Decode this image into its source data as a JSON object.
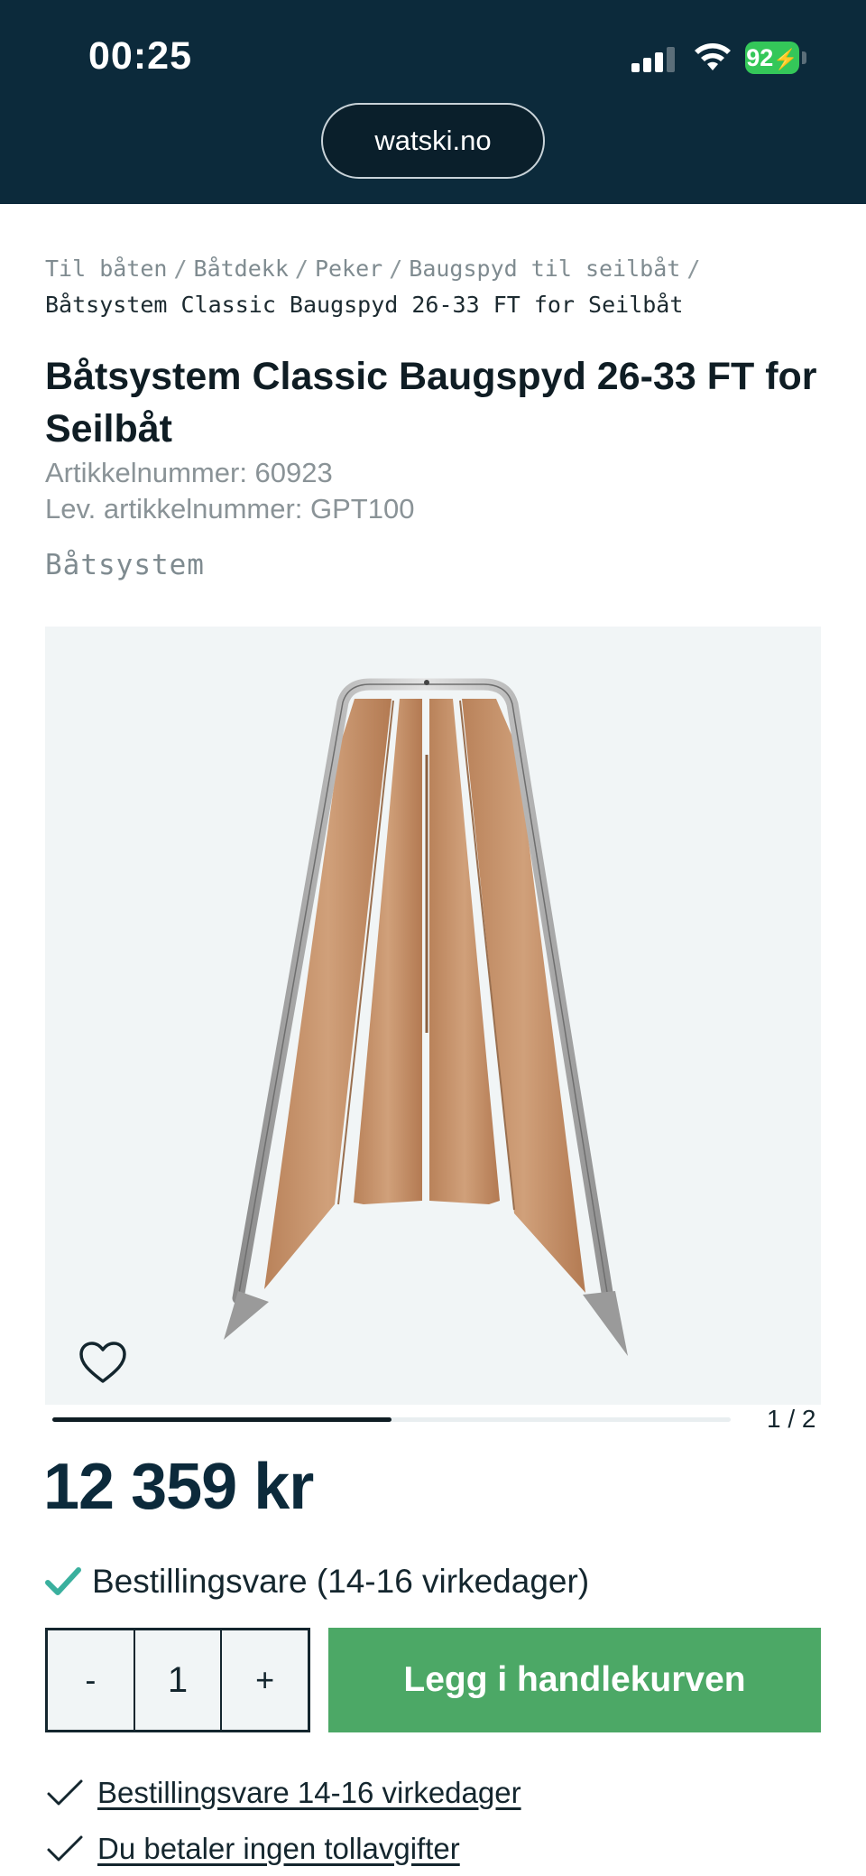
{
  "status_bar": {
    "time": "00:25",
    "battery": "92"
  },
  "browser": {
    "url": "watski.no"
  },
  "breadcrumb": {
    "items": [
      "Til båten",
      "Båtdekk",
      "Peker",
      "Baugspyd til seilbåt"
    ],
    "separator": "/",
    "current": "Båtsystem Classic Baugspyd 26-33 FT for Seilbåt"
  },
  "product": {
    "title": "Båtsystem Classic Baugspyd 26-33 FT for Seilbåt",
    "article_number": "Artikkelnummer: 60923",
    "supplier_article_number": "Lev. artikkelnummer: GPT100",
    "brand": "Båtsystem",
    "price": "12 359 kr",
    "stock_status": "Bestillingsvare (14-16 virkedager)"
  },
  "gallery": {
    "pager": "1 / 2",
    "current_image": 1,
    "total_images": 2,
    "progress_fraction": 0.5
  },
  "cart": {
    "decrement_label": "-",
    "quantity": "1",
    "increment_label": "+",
    "add_label": "Legg i handlekurven"
  },
  "usps": [
    "Bestillingsvare 14-16 virkedager",
    "Du betaler ingen tollavgifter"
  ],
  "colors": {
    "header_bg": "#0c2a3b",
    "accent_green": "#4ca866",
    "check_teal": "#3ab09e",
    "image_bg": "#f1f5f6"
  },
  "icons": {
    "favorite": "heart-outline-icon",
    "check": "checkmark-icon"
  }
}
